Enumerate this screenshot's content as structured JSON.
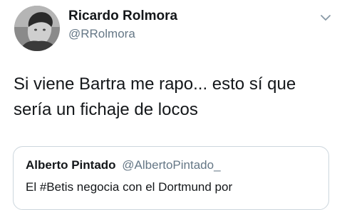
{
  "tweet": {
    "author": {
      "name": "Ricardo Rolmora",
      "handle": "@RRolmora",
      "avatar_icon": "user-avatar-photo"
    },
    "menu_icon": "chevron-down-icon",
    "text": "Si viene Bartra me rapo... esto sí que sería un fichaje de locos"
  },
  "quoted_tweet": {
    "author": {
      "name": "Alberto Pintado",
      "handle": "@AlbertoPintado_"
    },
    "text": "El #Betis negocia con el Dortmund por"
  },
  "colors": {
    "text_primary": "#14171a",
    "text_secondary": "#657786",
    "border": "#ccd6dd"
  }
}
